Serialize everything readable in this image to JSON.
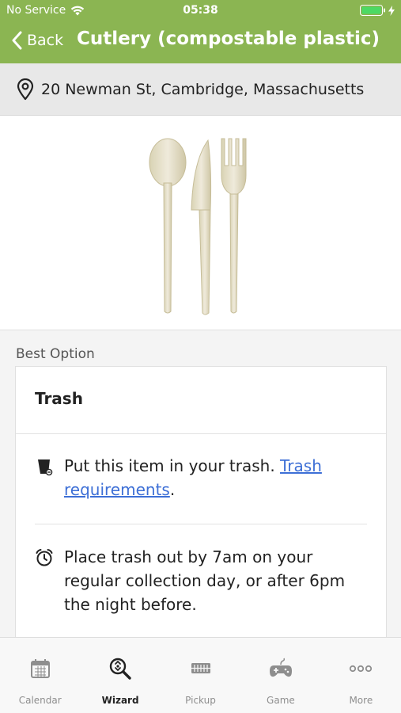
{
  "status_bar": {
    "carrier": "No Service",
    "time": "05:38"
  },
  "navbar": {
    "back_label": "Back",
    "title": "Cutlery (compostable plastic)"
  },
  "address": {
    "text": "20 Newman St, Cambridge, Massachusetts",
    "icon": "location-pin-icon"
  },
  "hero": {
    "image": "compostable-cutlery-image"
  },
  "content": {
    "best_option_label": "Best Option",
    "card": {
      "title": "Trash",
      "row1": {
        "icon": "trash-bin-icon",
        "text_before": "Put this item in your trash. ",
        "link_text": "Trash requirements",
        "text_after": "."
      },
      "row2": {
        "icon": "alarm-clock-icon",
        "text": "Place trash out by 7am on your regular collection day, or after 6pm the night before."
      }
    }
  },
  "tabbar": {
    "tabs": [
      {
        "label": "Calendar",
        "icon": "calendar-icon",
        "active": false
      },
      {
        "label": "Wizard",
        "icon": "recycle-search-icon",
        "active": true
      },
      {
        "label": "Pickup",
        "icon": "truck-icon",
        "active": false
      },
      {
        "label": "Game",
        "icon": "gamepad-icon",
        "active": false
      },
      {
        "label": "More",
        "icon": "more-dots-icon",
        "active": false
      }
    ]
  },
  "colors": {
    "accent_green": "#8bb552",
    "link_blue": "#3d6fd6"
  }
}
